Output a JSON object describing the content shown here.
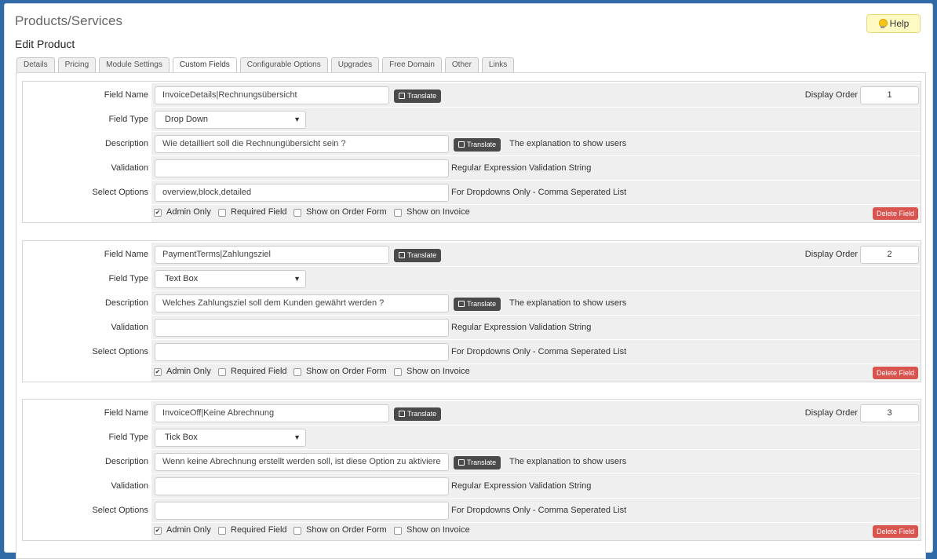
{
  "header": {
    "title": "Products/Services",
    "subtitle": "Edit Product",
    "help_label": "Help"
  },
  "tabs": [
    {
      "label": "Details"
    },
    {
      "label": "Pricing"
    },
    {
      "label": "Module Settings"
    },
    {
      "label": "Custom Fields",
      "active": true
    },
    {
      "label": "Configurable Options"
    },
    {
      "label": "Upgrades"
    },
    {
      "label": "Free Domain"
    },
    {
      "label": "Other"
    },
    {
      "label": "Links"
    }
  ],
  "labels": {
    "field_name": "Field Name",
    "field_type": "Field Type",
    "description": "Description",
    "validation": "Validation",
    "select_options": "Select Options",
    "display_order": "Display Order",
    "translate": "Translate",
    "description_hint": "The explanation to show users",
    "validation_hint": "Regular Expression Validation String",
    "select_hint": "For Dropdowns Only - Comma Seperated List",
    "admin_only": "Admin Only",
    "required_field": "Required Field",
    "show_on_order_form": "Show on Order Form",
    "show_on_invoice": "Show on Invoice",
    "delete_field": "Delete Field"
  },
  "fields": [
    {
      "name": "InvoiceDetails|Rechnungsübersicht",
      "type": "Drop Down",
      "description": "Wie detailliert soll die Rechnungübersicht sein ?",
      "validation": "",
      "select_options": "overview,block,detailed",
      "display_order": "1",
      "admin_only": true,
      "required": false,
      "order_form": false,
      "invoice": false
    },
    {
      "name": "PaymentTerms|Zahlungsziel",
      "type": "Text Box",
      "description": "Welches Zahlungsziel soll dem Kunden gewährt werden ?",
      "validation": "",
      "select_options": "",
      "display_order": "2",
      "admin_only": true,
      "required": false,
      "order_form": false,
      "invoice": false
    },
    {
      "name": "InvoiceOff|Keine Abrechnung",
      "type": "Tick Box",
      "description": "Wenn keine Abrechnung erstellt werden soll, ist diese Option zu aktiviere",
      "validation": "",
      "select_options": "",
      "display_order": "3",
      "admin_only": true,
      "required": false,
      "order_form": false,
      "invoice": false
    }
  ]
}
